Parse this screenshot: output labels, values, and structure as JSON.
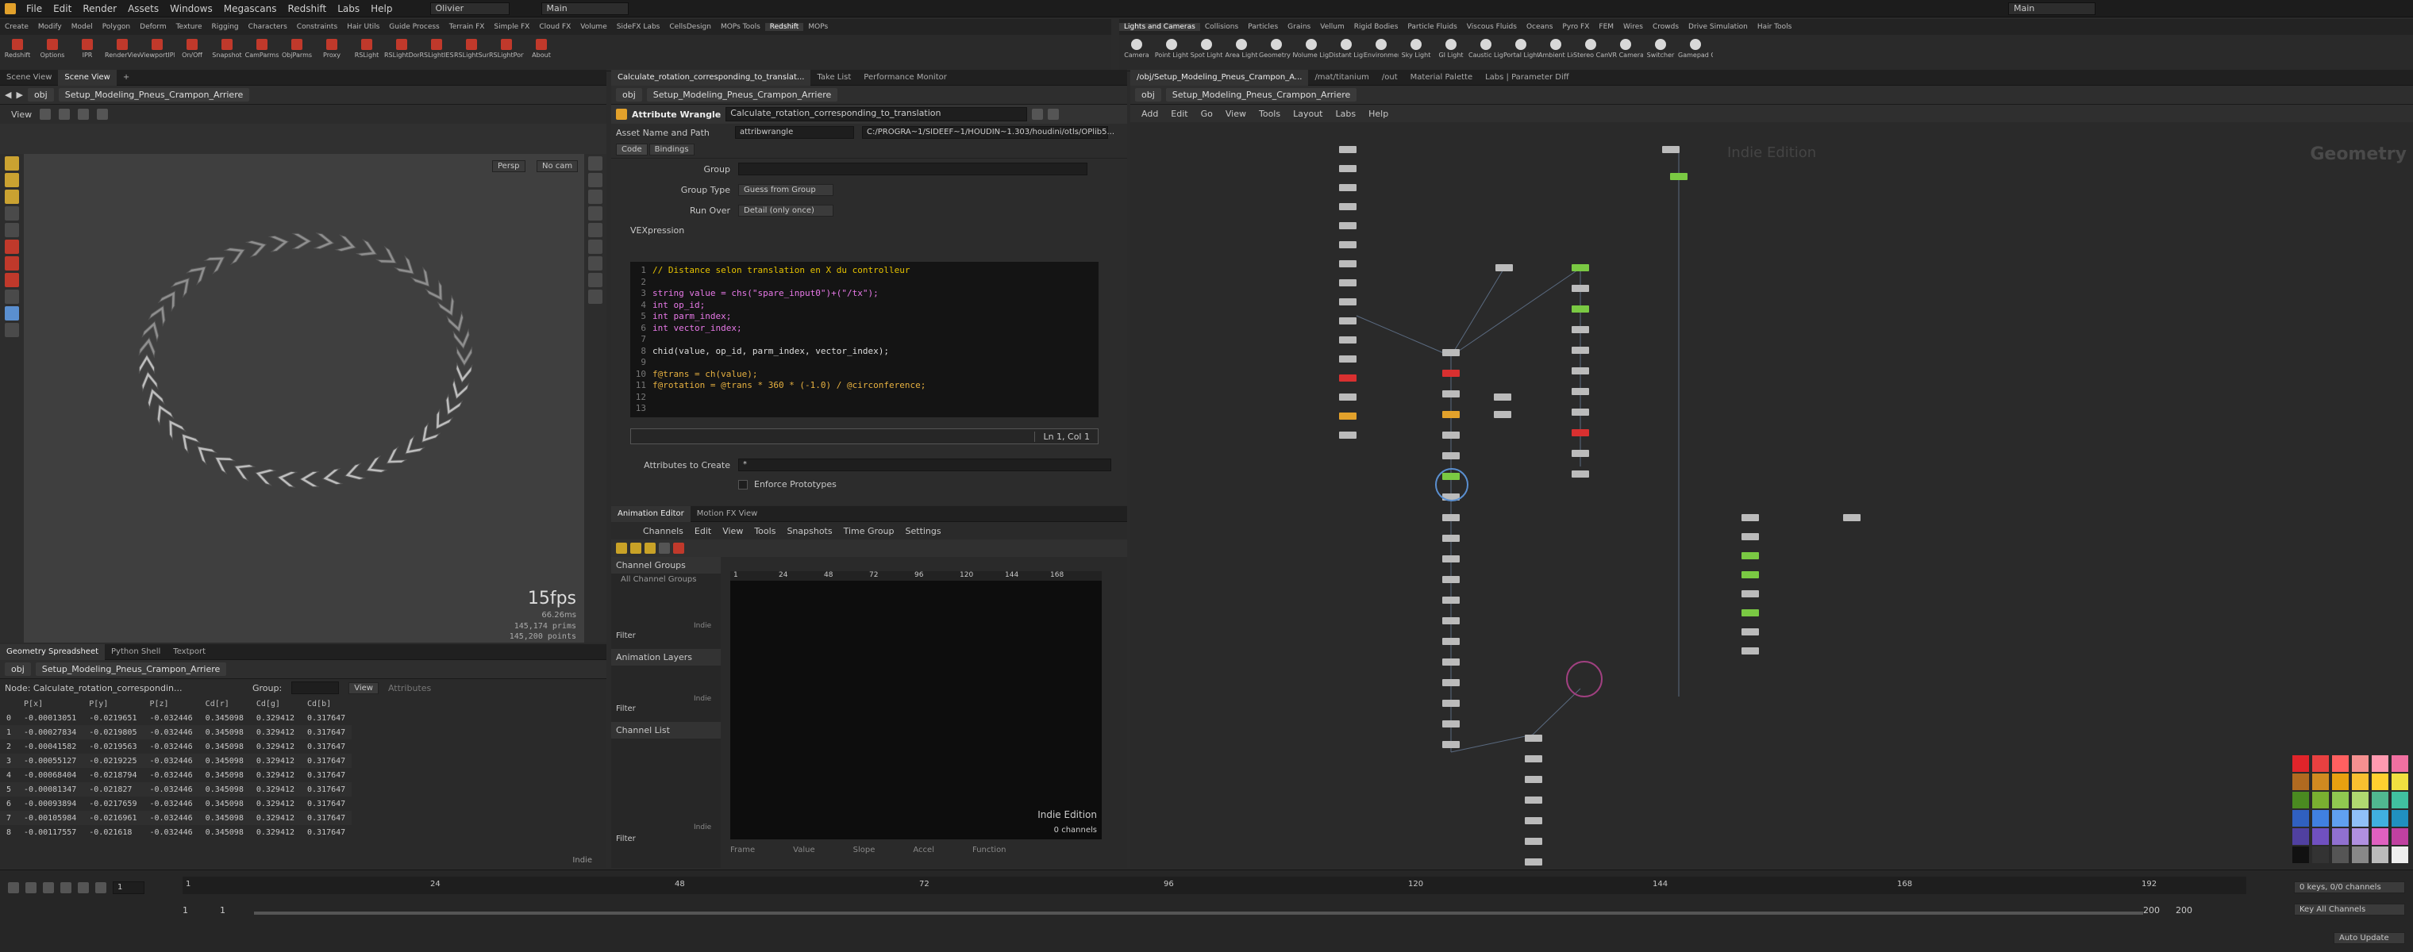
{
  "menu": [
    "File",
    "Edit",
    "Render",
    "Assets",
    "Windows",
    "Megascans",
    "Redshift",
    "Labs",
    "Help"
  ],
  "desktop": "Olivier",
  "desktop_right": "Main",
  "desktop_right2": "Main",
  "shelf_left": {
    "tabs": [
      "Create",
      "Modify",
      "Model",
      "Polygon",
      "Deform",
      "Texture",
      "Rigging",
      "Characters",
      "Constraints",
      "Hair Utils",
      "Guide Process",
      "Terrain FX",
      "Simple FX",
      "Cloud FX",
      "Volume",
      "SideFX Labs",
      "CellsDesign",
      "MOPs Tools",
      "Redshift",
      "MOPs"
    ],
    "tools": [
      "Redshift",
      "Options",
      "IPR",
      "RenderView",
      "ViewportIPR",
      "On/Off",
      "Snapshot",
      "CamParms",
      "ObjParms",
      "Proxy",
      "RSLight",
      "RSLightDome",
      "RSLightIES",
      "RSLightSun",
      "RSLightPortal",
      "About"
    ]
  },
  "shelf_right": {
    "tabs": [
      "Lights and Cameras",
      "Collisions",
      "Particles",
      "Grains",
      "Vellum",
      "Rigid Bodies",
      "Particle Fluids",
      "Viscous Fluids",
      "Oceans",
      "Pyro FX",
      "FEM",
      "Wires",
      "Crowds",
      "Drive Simulation",
      "Hair Tools"
    ],
    "tools": [
      "Camera",
      "Point Light",
      "Spot Light",
      "Area Light",
      "Geometry Light",
      "Volume Light",
      "Distant Light",
      "Environment Light",
      "Sky Light",
      "GI Light",
      "Caustic Light",
      "Portal Light",
      "Ambient Light",
      "Stereo Camera",
      "VR Camera",
      "Switcher",
      "Gamepad Camera"
    ]
  },
  "scene_tabs": [
    "Scene View",
    "Scene View"
  ],
  "obj_path": {
    "root": "obj",
    "node": "Setup_Modeling_Pneus_Crampon_Arriere"
  },
  "viewport": {
    "label": "View",
    "persp": "Persp",
    "cam": "No cam",
    "fps": "15fps",
    "ms": "66.26ms",
    "prims": "145,174 prims",
    "points": "145,200 points"
  },
  "spreadsheet": {
    "tabs": [
      "Geometry Spreadsheet",
      "Python Shell",
      "Textport"
    ],
    "node_label": "Node: Calculate_rotation_correspondin...",
    "group": "Group:",
    "view": "View",
    "attribs": "Attributes",
    "indie": "Indie",
    "columns": [
      "",
      "P[x]",
      "P[y]",
      "P[z]",
      "Cd[r]",
      "Cd[g]",
      "Cd[b]"
    ],
    "rows": [
      [
        "0",
        "-0.00013051",
        "-0.0219651",
        "-0.032446",
        "0.345098",
        "0.329412",
        "0.317647"
      ],
      [
        "1",
        "-0.00027834",
        "-0.0219805",
        "-0.032446",
        "0.345098",
        "0.329412",
        "0.317647"
      ],
      [
        "2",
        "-0.00041582",
        "-0.0219563",
        "-0.032446",
        "0.345098",
        "0.329412",
        "0.317647"
      ],
      [
        "3",
        "-0.00055127",
        "-0.0219225",
        "-0.032446",
        "0.345098",
        "0.329412",
        "0.317647"
      ],
      [
        "4",
        "-0.00068404",
        "-0.0218794",
        "-0.032446",
        "0.345098",
        "0.329412",
        "0.317647"
      ],
      [
        "5",
        "-0.00081347",
        "-0.021827",
        "-0.032446",
        "0.345098",
        "0.329412",
        "0.317647"
      ],
      [
        "6",
        "-0.00093894",
        "-0.0217659",
        "-0.032446",
        "0.345098",
        "0.329412",
        "0.317647"
      ],
      [
        "7",
        "-0.00105984",
        "-0.0216961",
        "-0.032446",
        "0.345098",
        "0.329412",
        "0.317647"
      ],
      [
        "8",
        "-0.00117557",
        "-0.021618",
        "-0.032446",
        "0.345098",
        "0.329412",
        "0.317647"
      ]
    ]
  },
  "param_tabs": [
    "Calculate_rotation_corresponding_to_translat...",
    "Take List",
    "Performance Monitor"
  ],
  "param": {
    "type": "Attribute Wrangle",
    "name": "Calculate_rotation_corresponding_to_translation",
    "asset_label": "Asset Name and Path",
    "asset_type": "attribwrangle",
    "asset_path": "C:/PROGRA~1/SIDEEF~1/HOUDIN~1.303/houdini/otls/OPlib5...",
    "tabs": [
      "Code",
      "Bindings"
    ],
    "group_label": "Group",
    "group_type_label": "Group Type",
    "group_type": "Guess from Group",
    "run_over_label": "Run Over",
    "run_over": "Detail (only once)",
    "vex_label": "VEXpression",
    "status": "Ln 1, Col 1",
    "attr_create_label": "Attributes to Create",
    "attr_create": "*",
    "enforce": "Enforce Prototypes"
  },
  "code_lines": [
    {
      "n": "1",
      "t": "// Distance selon translation en X du controlleur",
      "c": "cm"
    },
    {
      "n": "2",
      "t": "",
      "c": ""
    },
    {
      "n": "3",
      "t": "string value = chs(\"spare_input0\")+(\"/tx\");",
      "c": ""
    },
    {
      "n": "4",
      "t": "int op_id;",
      "c": ""
    },
    {
      "n": "5",
      "t": "int parm_index;",
      "c": ""
    },
    {
      "n": "6",
      "t": "int vector_index;",
      "c": ""
    },
    {
      "n": "7",
      "t": "",
      "c": ""
    },
    {
      "n": "8",
      "t": "chid(value, op_id, parm_index, vector_index);",
      "c": ""
    },
    {
      "n": "9",
      "t": "",
      "c": ""
    },
    {
      "n": "10",
      "t": "f@trans = ch(value);",
      "c": ""
    },
    {
      "n": "11",
      "t": "f@rotation = @trans * 360 * (-1.0) / @circonference;",
      "c": ""
    },
    {
      "n": "12",
      "t": "",
      "c": ""
    },
    {
      "n": "13",
      "t": "",
      "c": ""
    }
  ],
  "anim_tabs": [
    "Animation Editor",
    "Motion FX View"
  ],
  "anim": {
    "menus": [
      "Channels",
      "Edit",
      "View",
      "Tools",
      "Snapshots",
      "Time Group",
      "Settings"
    ],
    "channel_groups": "Channel Groups",
    "all_groups": "All Channel Groups",
    "filter": "Filter",
    "anim_layers": "Animation Layers",
    "channel_list": "Channel List",
    "indie": "Indie",
    "ticks": [
      "1",
      "24",
      "48",
      "72",
      "96",
      "120",
      "144",
      "168"
    ],
    "edition": "Indie Edition",
    "channels": "0 channels",
    "footer": [
      "Frame",
      "Value",
      "Slope",
      "Accel",
      "Function"
    ]
  },
  "net_tabs": [
    "/obj/Setup_Modeling_Pneus_Crampon_A...",
    "/mat/titanium",
    "/out",
    "Material Palette",
    "Labs | Parameter Diff"
  ],
  "net": {
    "menus": [
      "Add",
      "Edit",
      "Go",
      "View",
      "Tools",
      "Layout",
      "Labs",
      "Help"
    ],
    "watermark": "Indie Edition",
    "context": "Geometry"
  },
  "timeline": {
    "frame": "1",
    "start": "1",
    "end": "1",
    "ticks": [
      "1",
      "24",
      "48",
      "72",
      "96",
      "120",
      "144",
      "168",
      "192"
    ],
    "end1": "200",
    "end2": "200",
    "keys": "0 keys, 0/0 channels",
    "key_all": "Key All Channels",
    "auto_update": "Auto Update"
  },
  "colors": {
    "accent": "#e2a12b",
    "node_green": "#7ac943",
    "node_red": "#d93030"
  }
}
